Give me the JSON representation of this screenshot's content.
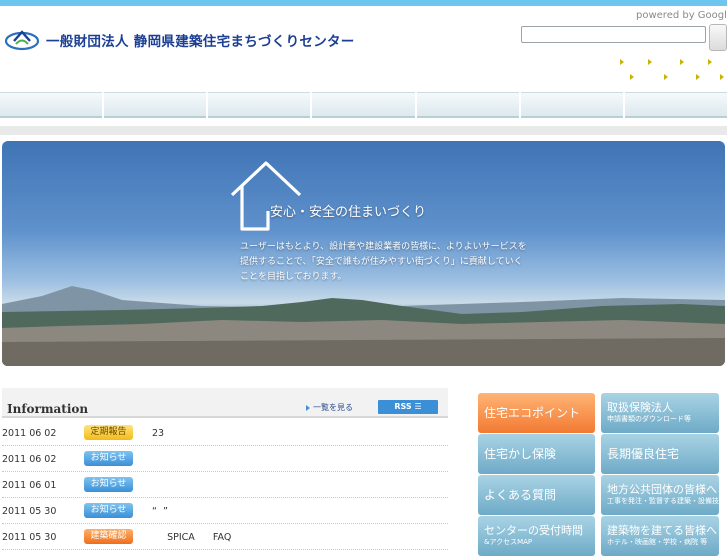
{
  "header": {
    "site_title": "一般財団法人 静岡県建築住宅まちづくりセンター",
    "powered_by": "powered by Google",
    "search_placeholder": ""
  },
  "hero": {
    "tagline": "安心・安全の住まいづくり",
    "body_lines": [
      "ユーザーはもとより、設計者や建設業者の皆様に、よりよいサービスを",
      "提供することで、「安全で誰もが住みやすい街づくり」に貢献していく",
      "ことを目指しております。"
    ]
  },
  "info": {
    "title": "Information",
    "list_link": "一覧を見る",
    "rss_label": "RSS",
    "items": [
      {
        "date": "2011 06 02",
        "badge": "定期報告",
        "badge_color": "yellow",
        "text": "23"
      },
      {
        "date": "2011 06 02",
        "badge": "お知らせ",
        "badge_color": "blue",
        "text": ""
      },
      {
        "date": "2011 06 01",
        "badge": "お知らせ",
        "badge_color": "blue",
        "text": ""
      },
      {
        "date": "2011 05 30",
        "badge": "お知らせ",
        "badge_color": "blue",
        "text": "“  ”"
      },
      {
        "date": "2011 05 30",
        "badge": "建築確認",
        "badge_color": "orange",
        "text": "     SPICA      FAQ"
      }
    ]
  },
  "banners": [
    {
      "main": "住宅エコポイント",
      "sub": "",
      "style": "orange"
    },
    {
      "main": "取扱保険法人",
      "sub": "申請書類のダウンロード等",
      "style": "teal"
    },
    {
      "main": "住宅かし保険",
      "sub": "",
      "style": "teal"
    },
    {
      "main": "長期優良住宅",
      "sub": "",
      "style": "teal"
    },
    {
      "main": "よくある質問",
      "sub": "",
      "style": "teal"
    },
    {
      "main": "地方公共団体の皆様へ",
      "sub": "工事を発注・監督する建築・設備技術者を支援します！",
      "style": "teal"
    },
    {
      "main": "センターの受付時間",
      "sub": "&アクセスMAP",
      "style": "teal"
    },
    {
      "main": "建築物を建てる皆様へ",
      "sub": "ホテル・映画館・学校・病院 等",
      "style": "teal"
    }
  ],
  "colors": {
    "top_bar": "#6cc6ee",
    "brand_blue": "#1b3f93",
    "rss_blue": "#3a8fd6",
    "eco_orange": "#f27a32",
    "banner_teal": "#6eaac7"
  },
  "icons": {
    "logo": "foundation-logo-mark",
    "hero": "house-outline-icon",
    "rss": "rss-icon"
  }
}
